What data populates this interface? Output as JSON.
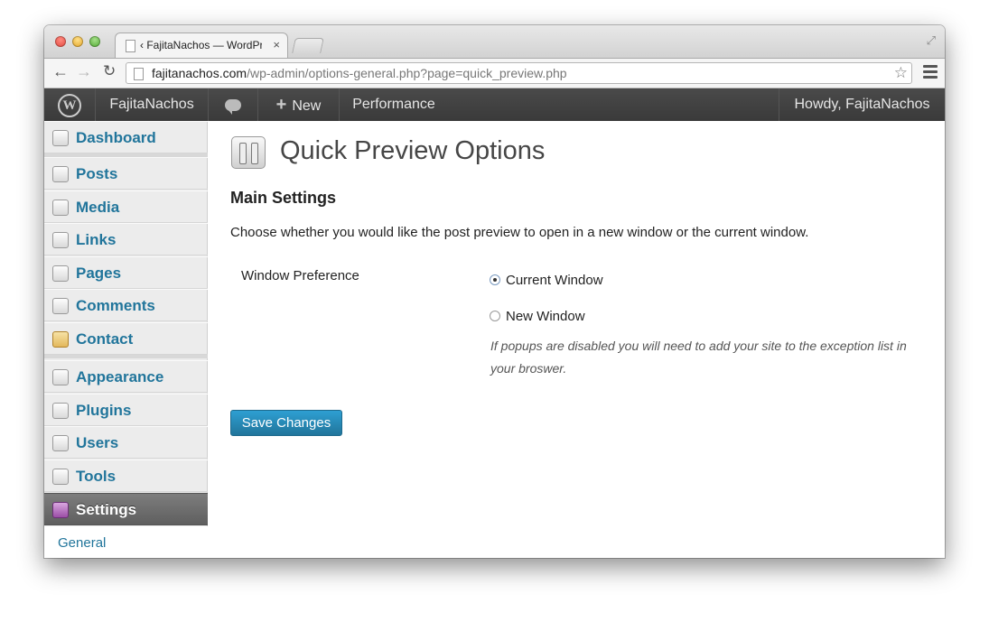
{
  "browser": {
    "tab_title": "‹ FajitaNachos — WordPres",
    "tab_close": "×",
    "url_host": "fajitanachos.com",
    "url_path": "/wp-admin/options-general.php?page=quick_preview.php",
    "back_icon": "←",
    "forward_icon": "→",
    "reload_icon": "↻",
    "star_icon": "☆",
    "fullscreen_icon": "⤢"
  },
  "adminbar": {
    "wp_logo": "W",
    "site_name": "FajitaNachos",
    "new_plus": "+",
    "new_label": "New",
    "performance": "Performance",
    "howdy": "Howdy, FajitaNachos"
  },
  "sidebar": {
    "items": [
      {
        "label": "Dashboard"
      },
      {
        "label": "Posts"
      },
      {
        "label": "Media"
      },
      {
        "label": "Links"
      },
      {
        "label": "Pages"
      },
      {
        "label": "Comments"
      },
      {
        "label": "Contact"
      },
      {
        "label": "Appearance"
      },
      {
        "label": "Plugins"
      },
      {
        "label": "Users"
      },
      {
        "label": "Tools"
      },
      {
        "label": "Settings"
      }
    ],
    "submenu_general": "General"
  },
  "content": {
    "page_title": "Quick Preview Options",
    "section_title": "Main Settings",
    "section_desc": "Choose whether you would like the post preview to open in a new window or the current window.",
    "field_label": "Window Preference",
    "option_current": "Current Window",
    "option_new": "New Window",
    "note": "If popups are disabled you will need to add your site to the exception list in your broswer.",
    "save_button": "Save Changes"
  },
  "colors": {
    "link": "#21759b",
    "adminbar": "#464646",
    "button": "#2e8bb8"
  }
}
